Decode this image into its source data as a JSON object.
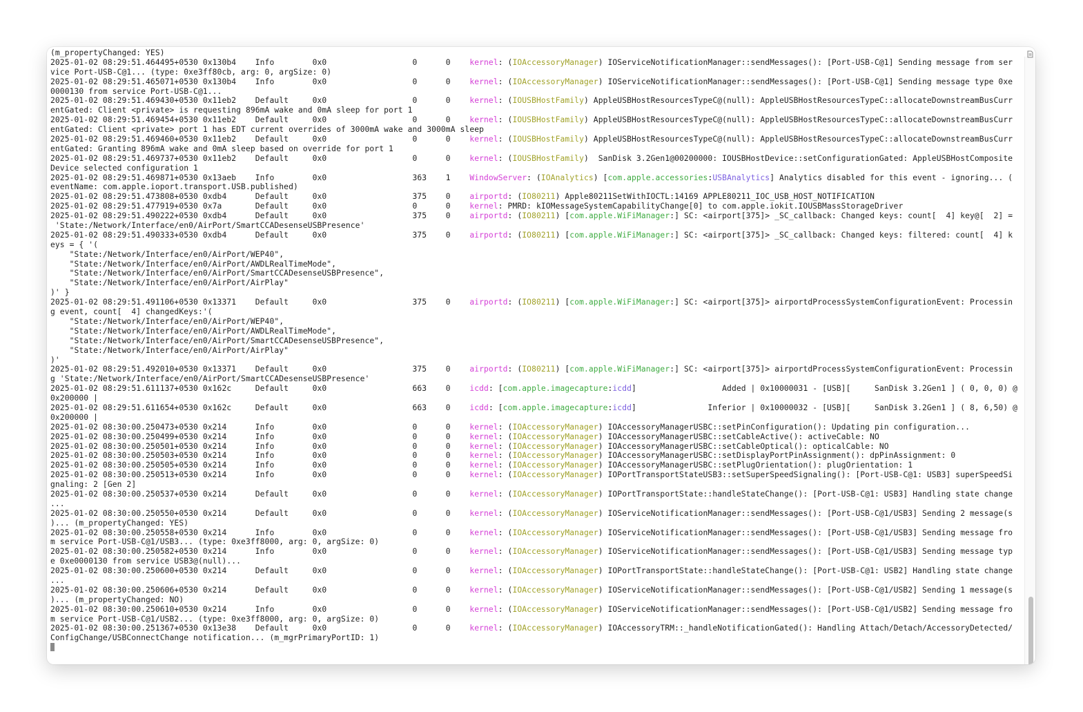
{
  "window": {
    "type": "terminal-log",
    "colors": {
      "process": "#d43fd6",
      "subsystem": "#a1a22a",
      "namespace": "#3fab42",
      "category": "#7b5ee0",
      "text": "#1f1f1f"
    },
    "icons": {
      "top_right": "document-icon"
    }
  },
  "lines": [
    [
      {
        "t": "(m_propertyChanged: YES)"
      }
    ],
    [
      {
        "t": "2025-01-02 08:29:51.464495+0530 0x130b4    Info        0x0                  0      0    "
      },
      {
        "t": "kernel",
        "c": "proc"
      },
      {
        "t": ": ("
      },
      {
        "t": "IOAccessoryManager",
        "c": "sub"
      },
      {
        "t": ") IOServiceNotificationManager::sendMessages(): [Port-USB-C@1] Sending message from ser"
      }
    ],
    [
      {
        "t": "vice Port-USB-C@1... (type: 0xe3ff80cb, arg: 0, argSize: 0)"
      }
    ],
    [
      {
        "t": "2025-01-02 08:29:51.465071+0530 0x130b4    Info        0x0                  0      0    "
      },
      {
        "t": "kernel",
        "c": "proc"
      },
      {
        "t": ": ("
      },
      {
        "t": "IOAccessoryManager",
        "c": "sub"
      },
      {
        "t": ") IOServiceNotificationManager::sendMessages(): [Port-USB-C@1] Sending message type 0xe"
      }
    ],
    [
      {
        "t": "0000130 from service Port-USB-C@1..."
      }
    ],
    [
      {
        "t": "2025-01-02 08:29:51.469430+0530 0x11eb2    Default     0x0                  0      0    "
      },
      {
        "t": "kernel",
        "c": "proc"
      },
      {
        "t": ": ("
      },
      {
        "t": "IOUSBHostFamily",
        "c": "sub"
      },
      {
        "t": ") AppleUSBHostResourcesTypeC@(null): AppleUSBHostResourcesTypeC::allocateDownstreamBusCurr"
      }
    ],
    [
      {
        "t": "entGated: Client <private> is requesting 896mA wake and 0mA sleep for port 1"
      }
    ],
    [
      {
        "t": "2025-01-02 08:29:51.469454+0530 0x11eb2    Default     0x0                  0      0    "
      },
      {
        "t": "kernel",
        "c": "proc"
      },
      {
        "t": ": ("
      },
      {
        "t": "IOUSBHostFamily",
        "c": "sub"
      },
      {
        "t": ") AppleUSBHostResourcesTypeC@(null): AppleUSBHostResourcesTypeC::allocateDownstreamBusCurr"
      }
    ],
    [
      {
        "t": "entGated: Client <private> port 1 has EDT current overrides of 3000mA wake and 3000mA sleep"
      }
    ],
    [
      {
        "t": "2025-01-02 08:29:51.469460+0530 0x11eb2    Default     0x0                  0      0    "
      },
      {
        "t": "kernel",
        "c": "proc"
      },
      {
        "t": ": ("
      },
      {
        "t": "IOUSBHostFamily",
        "c": "sub"
      },
      {
        "t": ") AppleUSBHostResourcesTypeC@(null): AppleUSBHostResourcesTypeC::allocateDownstreamBusCurr"
      }
    ],
    [
      {
        "t": "entGated: Granting 896mA wake and 0mA sleep based on override for port 1"
      }
    ],
    [
      {
        "t": "2025-01-02 08:29:51.469737+0530 0x11eb2    Default     0x0                  0      0    "
      },
      {
        "t": "kernel",
        "c": "proc"
      },
      {
        "t": ": ("
      },
      {
        "t": "IOUSBHostFamily",
        "c": "sub"
      },
      {
        "t": ")  SanDisk 3.2Gen1@00200000: IOUSBHostDevice::setConfigurationGated: AppleUSBHostComposite"
      }
    ],
    [
      {
        "t": "Device selected configuration 1"
      }
    ],
    [
      {
        "t": "2025-01-02 08:29:51.469871+0530 0x13aeb    Info        0x0                  363    1    "
      },
      {
        "t": "WindowServer",
        "c": "proc"
      },
      {
        "t": ": ("
      },
      {
        "t": "IOAnalytics",
        "c": "sub"
      },
      {
        "t": ") ["
      },
      {
        "t": "com.apple.accessories",
        "c": "ns"
      },
      {
        "t": ":"
      },
      {
        "t": "USBAnalytics",
        "c": "cat"
      },
      {
        "t": "] Analytics disabled for this event - ignoring... ("
      }
    ],
    [
      {
        "t": "eventName: com.apple.ioport.transport.USB.published)"
      }
    ],
    [
      {
        "t": "2025-01-02 08:29:51.473808+0530 0xdb4      Default     0x0                  375    0    "
      },
      {
        "t": "airportd",
        "c": "proc"
      },
      {
        "t": ": ("
      },
      {
        "t": "IO80211",
        "c": "sub"
      },
      {
        "t": ") Apple80211SetWithIOCTL:14169 APPLE80211_IOC_USB_HOST_NOTIFICATION"
      }
    ],
    [
      {
        "t": "2025-01-02 08:29:51.477919+0530 0x7a       Default     0x0                  0      0    "
      },
      {
        "t": "kernel",
        "c": "proc"
      },
      {
        "t": ": PMRD: kIOMessageSystemCapabilityChange[0] to com.apple.iokit.IOUSBMassStorageDriver"
      }
    ],
    [
      {
        "t": "2025-01-02 08:29:51.490222+0530 0xdb4      Default     0x0                  375    0    "
      },
      {
        "t": "airportd",
        "c": "proc"
      },
      {
        "t": ": ("
      },
      {
        "t": "IO80211",
        "c": "sub"
      },
      {
        "t": ") ["
      },
      {
        "t": "com.apple.WiFiManager",
        "c": "ns"
      },
      {
        "t": ":] SC: <airport[375]> _SC_callback: Changed keys: count[  4] key@[  2] ="
      }
    ],
    [
      {
        "t": " 'State:/Network/Interface/en0/AirPort/SmartCCADesenseUSBPresence'"
      }
    ],
    [
      {
        "t": "2025-01-02 08:29:51.490333+0530 0xdb4      Default     0x0                  375    0    "
      },
      {
        "t": "airportd",
        "c": "proc"
      },
      {
        "t": ": ("
      },
      {
        "t": "IO80211",
        "c": "sub"
      },
      {
        "t": ") ["
      },
      {
        "t": "com.apple.WiFiManager",
        "c": "ns"
      },
      {
        "t": ":] SC: <airport[375]> _SC_callback: Changed keys: filtered: count[  4] k"
      }
    ],
    [
      {
        "t": "eys = { '("
      }
    ],
    [
      {
        "t": "    \"State:/Network/Interface/en0/AirPort/WEP40\","
      }
    ],
    [
      {
        "t": "    \"State:/Network/Interface/en0/AirPort/AWDLRealTimeMode\","
      }
    ],
    [
      {
        "t": "    \"State:/Network/Interface/en0/AirPort/SmartCCADesenseUSBPresence\","
      }
    ],
    [
      {
        "t": "    \"State:/Network/Interface/en0/AirPort/AirPlay\""
      }
    ],
    [
      {
        "t": ")' }"
      }
    ],
    [
      {
        "t": "2025-01-02 08:29:51.491106+0530 0x13371    Default     0x0                  375    0    "
      },
      {
        "t": "airportd",
        "c": "proc"
      },
      {
        "t": ": ("
      },
      {
        "t": "IO80211",
        "c": "sub"
      },
      {
        "t": ") ["
      },
      {
        "t": "com.apple.WiFiManager",
        "c": "ns"
      },
      {
        "t": ":] SC: <airport[375]> airportdProcessSystemConfigurationEvent: Processin"
      }
    ],
    [
      {
        "t": "g event, count[  4] changedKeys:'("
      }
    ],
    [
      {
        "t": "    \"State:/Network/Interface/en0/AirPort/WEP40\","
      }
    ],
    [
      {
        "t": "    \"State:/Network/Interface/en0/AirPort/AWDLRealTimeMode\","
      }
    ],
    [
      {
        "t": "    \"State:/Network/Interface/en0/AirPort/SmartCCADesenseUSBPresence\","
      }
    ],
    [
      {
        "t": "    \"State:/Network/Interface/en0/AirPort/AirPlay\""
      }
    ],
    [
      {
        "t": ")'"
      }
    ],
    [
      {
        "t": "2025-01-02 08:29:51.492010+0530 0x13371    Default     0x0                  375    0    "
      },
      {
        "t": "airportd",
        "c": "proc"
      },
      {
        "t": ": ("
      },
      {
        "t": "IO80211",
        "c": "sub"
      },
      {
        "t": ") ["
      },
      {
        "t": "com.apple.WiFiManager",
        "c": "ns"
      },
      {
        "t": ":] SC: <airport[375]> airportdProcessSystemConfigurationEvent: Processin"
      }
    ],
    [
      {
        "t": "g 'State:/Network/Interface/en0/AirPort/SmartCCADesenseUSBPresence'"
      }
    ],
    [
      {
        "t": "2025-01-02 08:29:51.611137+0530 0x162c     Default     0x0                  663    0    "
      },
      {
        "t": "icdd",
        "c": "proc"
      },
      {
        "t": ": ["
      },
      {
        "t": "com.apple.imagecapture",
        "c": "ns"
      },
      {
        "t": ":"
      },
      {
        "t": "icdd",
        "c": "cat"
      },
      {
        "t": "]                  Added | 0x10000031 - [USB][     SanDisk 3.2Gen1 ] ( 0, 0, 0) @"
      }
    ],
    [
      {
        "t": "0x200000 |"
      }
    ],
    [
      {
        "t": "2025-01-02 08:29:51.611654+0530 0x162c     Default     0x0                  663    0    "
      },
      {
        "t": "icdd",
        "c": "proc"
      },
      {
        "t": ": ["
      },
      {
        "t": "com.apple.imagecapture",
        "c": "ns"
      },
      {
        "t": ":"
      },
      {
        "t": "icdd",
        "c": "cat"
      },
      {
        "t": "]               Inferior | 0x10000032 - [USB][     SanDisk 3.2Gen1 ] ( 8, 6,50) @"
      }
    ],
    [
      {
        "t": "0x200000 |"
      }
    ],
    [
      {
        "t": "2025-01-02 08:30:00.250473+0530 0x214      Info        0x0                  0      0    "
      },
      {
        "t": "kernel",
        "c": "proc"
      },
      {
        "t": ": ("
      },
      {
        "t": "IOAccessoryManager",
        "c": "sub"
      },
      {
        "t": ") IOAccessoryManagerUSBC::setPinConfiguration(): Updating pin configuration..."
      }
    ],
    [
      {
        "t": "2025-01-02 08:30:00.250499+0530 0x214      Info        0x0                  0      0    "
      },
      {
        "t": "kernel",
        "c": "proc"
      },
      {
        "t": ": ("
      },
      {
        "t": "IOAccessoryManager",
        "c": "sub"
      },
      {
        "t": ") IOAccessoryManagerUSBC::setCableActive(): activeCable: NO"
      }
    ],
    [
      {
        "t": "2025-01-02 08:30:00.250501+0530 0x214      Info        0x0                  0      0    "
      },
      {
        "t": "kernel",
        "c": "proc"
      },
      {
        "t": ": ("
      },
      {
        "t": "IOAccessoryManager",
        "c": "sub"
      },
      {
        "t": ") IOAccessoryManagerUSBC::setCableOptical(): opticalCable: NO"
      }
    ],
    [
      {
        "t": "2025-01-02 08:30:00.250503+0530 0x214      Info        0x0                  0      0    "
      },
      {
        "t": "kernel",
        "c": "proc"
      },
      {
        "t": ": ("
      },
      {
        "t": "IOAccessoryManager",
        "c": "sub"
      },
      {
        "t": ") IOAccessoryManagerUSBC::setDisplayPortPinAssignment(): dpPinAssignment: 0"
      }
    ],
    [
      {
        "t": "2025-01-02 08:30:00.250505+0530 0x214      Info        0x0                  0      0    "
      },
      {
        "t": "kernel",
        "c": "proc"
      },
      {
        "t": ": ("
      },
      {
        "t": "IOAccessoryManager",
        "c": "sub"
      },
      {
        "t": ") IOAccessoryManagerUSBC::setPlugOrientation(): plugOrientation: 1"
      }
    ],
    [
      {
        "t": "2025-01-02 08:30:00.250513+0530 0x214      Info        0x0                  0      0    "
      },
      {
        "t": "kernel",
        "c": "proc"
      },
      {
        "t": ": ("
      },
      {
        "t": "IOAccessoryManager",
        "c": "sub"
      },
      {
        "t": ") IOPortTransportStateUSB3::setSuperSpeedSignaling(): [Port-USB-C@1: USB3] superSpeedSi"
      }
    ],
    [
      {
        "t": "gnaling: 2 [Gen 2]"
      }
    ],
    [
      {
        "t": "2025-01-02 08:30:00.250537+0530 0x214      Default     0x0                  0      0    "
      },
      {
        "t": "kernel",
        "c": "proc"
      },
      {
        "t": ": ("
      },
      {
        "t": "IOAccessoryManager",
        "c": "sub"
      },
      {
        "t": ") IOPortTransportState::handleStateChange(): [Port-USB-C@1: USB3] Handling state change"
      }
    ],
    [
      {
        "t": "..."
      }
    ],
    [
      {
        "t": "2025-01-02 08:30:00.250550+0530 0x214      Default     0x0                  0      0    "
      },
      {
        "t": "kernel",
        "c": "proc"
      },
      {
        "t": ": ("
      },
      {
        "t": "IOAccessoryManager",
        "c": "sub"
      },
      {
        "t": ") IOServiceNotificationManager::sendMessages(): [Port-USB-C@1/USB3] Sending 2 message(s"
      }
    ],
    [
      {
        "t": ")... (m_propertyChanged: YES)"
      }
    ],
    [
      {
        "t": "2025-01-02 08:30:00.250558+0530 0x214      Info        0x0                  0      0    "
      },
      {
        "t": "kernel",
        "c": "proc"
      },
      {
        "t": ": ("
      },
      {
        "t": "IOAccessoryManager",
        "c": "sub"
      },
      {
        "t": ") IOServiceNotificationManager::sendMessages(): [Port-USB-C@1/USB3] Sending message fro"
      }
    ],
    [
      {
        "t": "m service Port-USB-C@1/USB3... (type: 0xe3ff8000, arg: 0, argSize: 0)"
      }
    ],
    [
      {
        "t": "2025-01-02 08:30:00.250582+0530 0x214      Info        0x0                  0      0    "
      },
      {
        "t": "kernel",
        "c": "proc"
      },
      {
        "t": ": ("
      },
      {
        "t": "IOAccessoryManager",
        "c": "sub"
      },
      {
        "t": ") IOServiceNotificationManager::sendMessages(): [Port-USB-C@1/USB3] Sending message typ"
      }
    ],
    [
      {
        "t": "e 0xe0000130 from service USB3@(null)..."
      }
    ],
    [
      {
        "t": "2025-01-02 08:30:00.250600+0530 0x214      Default     0x0                  0      0    "
      },
      {
        "t": "kernel",
        "c": "proc"
      },
      {
        "t": ": ("
      },
      {
        "t": "IOAccessoryManager",
        "c": "sub"
      },
      {
        "t": ") IOPortTransportState::handleStateChange(): [Port-USB-C@1: USB2] Handling state change"
      }
    ],
    [
      {
        "t": "..."
      }
    ],
    [
      {
        "t": "2025-01-02 08:30:00.250606+0530 0x214      Default     0x0                  0      0    "
      },
      {
        "t": "kernel",
        "c": "proc"
      },
      {
        "t": ": ("
      },
      {
        "t": "IOAccessoryManager",
        "c": "sub"
      },
      {
        "t": ") IOServiceNotificationManager::sendMessages(): [Port-USB-C@1/USB2] Sending 1 message(s"
      }
    ],
    [
      {
        "t": ")... (m_propertyChanged: NO)"
      }
    ],
    [
      {
        "t": "2025-01-02 08:30:00.250610+0530 0x214      Info        0x0                  0      0    "
      },
      {
        "t": "kernel",
        "c": "proc"
      },
      {
        "t": ": ("
      },
      {
        "t": "IOAccessoryManager",
        "c": "sub"
      },
      {
        "t": ") IOServiceNotificationManager::sendMessages(): [Port-USB-C@1/USB2] Sending message fro"
      }
    ],
    [
      {
        "t": "m service Port-USB-C@1/USB2... (type: 0xe3ff8000, arg: 0, argSize: 0)"
      }
    ],
    [
      {
        "t": "2025-01-02 08:30:00.251367+0530 0x13e38    Default     0x0                  0      0    "
      },
      {
        "t": "kernel",
        "c": "proc"
      },
      {
        "t": ": ("
      },
      {
        "t": "IOAccessoryManager",
        "c": "sub"
      },
      {
        "t": ") IOAccessoryTRM::_handleNotificationGated(): Handling Attach/Detach/AccessoryDetected/"
      }
    ],
    [
      {
        "t": "ConfigChange/USBConnectChange notification... (m_mgrPrimaryPortID: 1)"
      }
    ]
  ],
  "scrollbar": {
    "position_fraction": 0.95
  }
}
